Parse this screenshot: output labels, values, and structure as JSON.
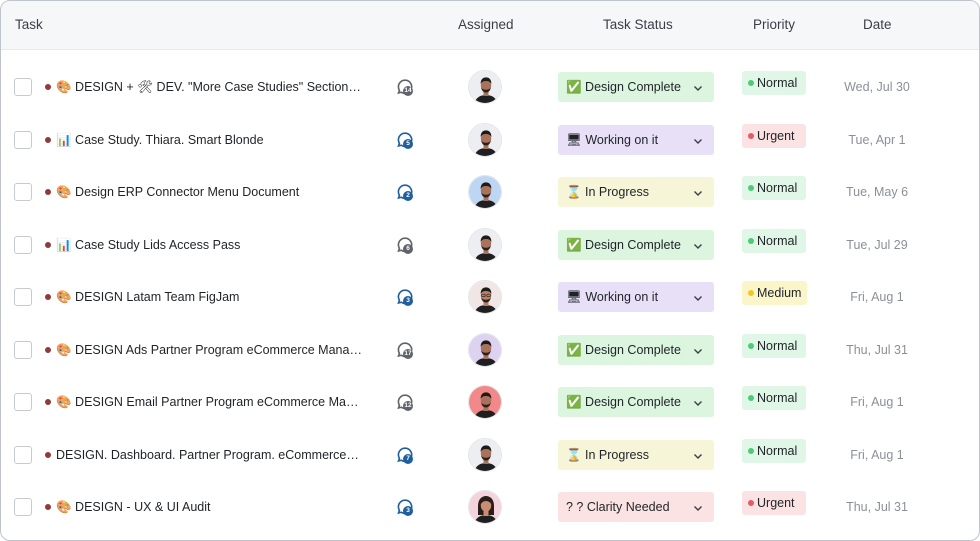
{
  "header": {
    "task": "Task",
    "assigned": "Assigned",
    "status": "Task Status",
    "priority": "Priority",
    "date": "Date"
  },
  "colors": {
    "status_design_complete": "#dcf5df",
    "status_working": "#e7e0f7",
    "status_in_progress": "#f7f5d8",
    "status_clarity": "#fbe2e3",
    "priority_normal_bg": "#e0f6e6",
    "priority_normal_dot": "#4ecb77",
    "priority_urgent_bg": "#fbe2e3",
    "priority_urgent_dot": "#e55b63",
    "priority_medium_bg": "#fbf6c9",
    "priority_medium_dot": "#f2c623",
    "comment_icon_blue": "#1f5f9e",
    "comment_icon_gray": "#5f646b"
  },
  "rows": [
    {
      "task": "🎨 DESIGN + 🛠 DEV. \"More Case Studies\" Section, not all...",
      "comments": "14",
      "comment_color": "gray",
      "avatar": "man-dark-beard",
      "status": "✅ Design Complete",
      "status_kind": "design_complete",
      "priority": "Normal",
      "priority_kind": "normal",
      "date": "Wed, Jul 30"
    },
    {
      "task": "📊 Case Study. Thiara. Smart Blonde",
      "comments": "5",
      "comment_color": "blue",
      "avatar": "man-dark-beard",
      "status": "🖥 Working on it",
      "status_kind": "working",
      "priority": "Urgent",
      "priority_kind": "urgent",
      "date": "Tue, Apr 1"
    },
    {
      "task": "🎨 Design ERP Connector Menu Document",
      "comments": "2",
      "comment_color": "blue",
      "avatar": "man-blue-bg",
      "status": "⌛ In Progress",
      "status_kind": "in_progress",
      "priority": "Normal",
      "priority_kind": "normal",
      "date": "Tue, May 6"
    },
    {
      "task": "📊 Case Study Lids Access Pass",
      "comments": "6",
      "comment_color": "gray",
      "avatar": "man-dark-beard",
      "status": "✅ Design Complete",
      "status_kind": "design_complete",
      "priority": "Normal",
      "priority_kind": "normal",
      "date": "Tue, Jul 29"
    },
    {
      "task": "🎨 DESIGN Latam Team FigJam",
      "comments": "3",
      "comment_color": "blue",
      "avatar": "man-glasses-light",
      "status": "🖥 Working on it",
      "status_kind": "working",
      "priority": "Medium",
      "priority_kind": "medium",
      "date": "Fri, Aug 1"
    },
    {
      "task": "🎨 DESIGN Ads Partner Program eCommerce Managers",
      "comments": "17",
      "comment_color": "gray",
      "avatar": "man-purple-bg",
      "status": "✅ Design Complete",
      "status_kind": "design_complete",
      "priority": "Normal",
      "priority_kind": "normal",
      "date": "Thu, Jul 31"
    },
    {
      "task": "🎨 DESIGN Email Partner Program eCommerce Managers",
      "comments": "12",
      "comment_color": "gray",
      "avatar": "man-red-bg",
      "status": "✅ Design Complete",
      "status_kind": "design_complete",
      "priority": "Normal",
      "priority_kind": "normal",
      "date": "Fri, Aug 1"
    },
    {
      "task": "DESIGN. Dashboard. Partner Program. eCommerce M...",
      "comments": "7",
      "comment_color": "blue",
      "avatar": "man-dark-beard",
      "status": "⌛ In Progress",
      "status_kind": "in_progress",
      "priority": "Normal",
      "priority_kind": "normal",
      "date": "Fri, Aug 1"
    },
    {
      "task": "🎨 DESIGN - UX & UI Audit",
      "comments": "3",
      "comment_color": "blue",
      "avatar": "woman-pink-bg",
      "status": "? ? Clarity Needed",
      "status_kind": "clarity",
      "priority": "Urgent",
      "priority_kind": "urgent",
      "date": "Thu, Jul 31"
    }
  ]
}
